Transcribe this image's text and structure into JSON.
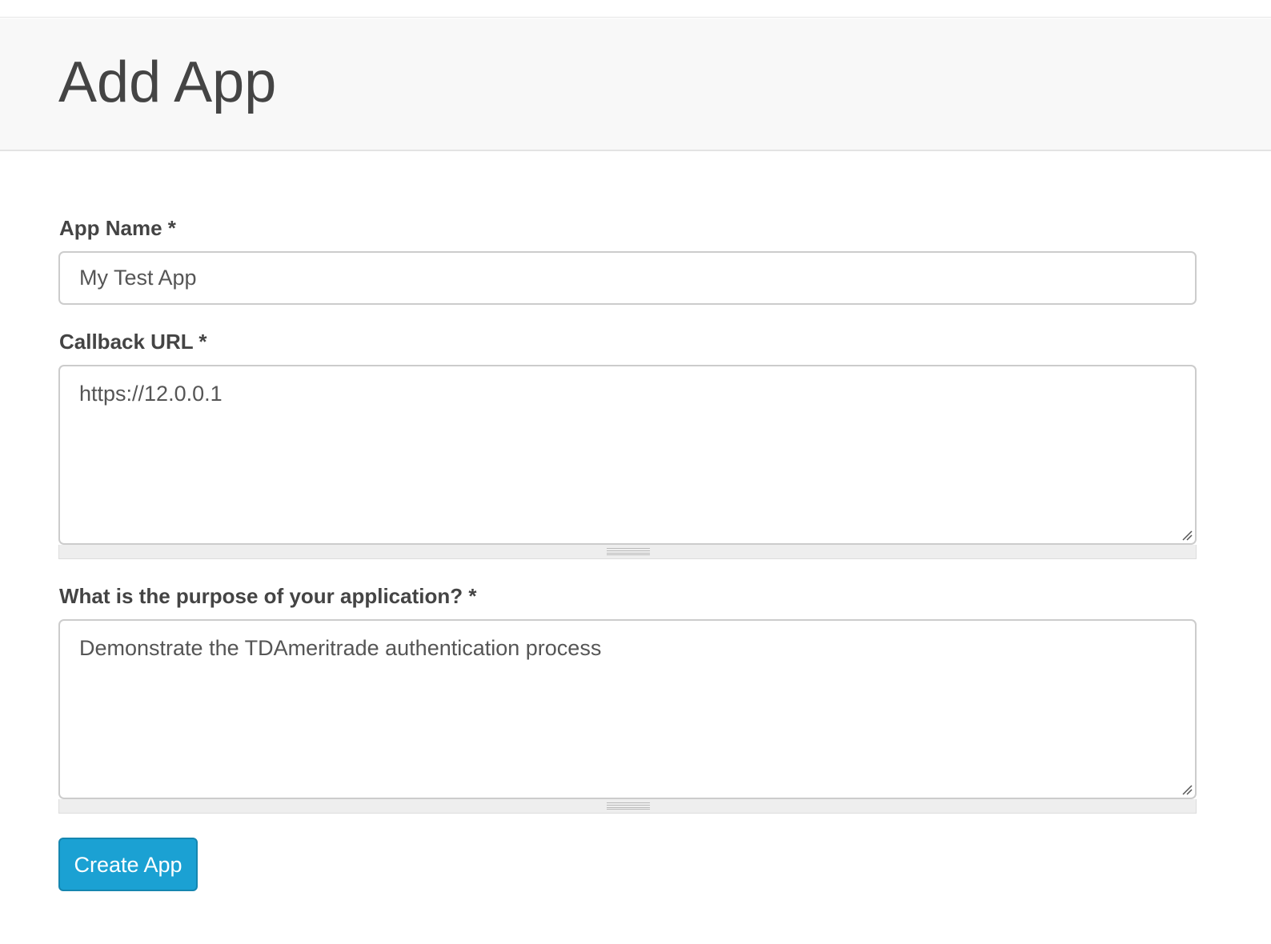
{
  "page": {
    "title": "Add App"
  },
  "form": {
    "app_name": {
      "label": "App Name *",
      "value": "My Test App"
    },
    "callback_url": {
      "label": "Callback URL *",
      "value": "https://12.0.0.1"
    },
    "purpose": {
      "label": "What is the purpose of your application? *",
      "value": "Demonstrate the TDAmeritrade authentication process"
    },
    "submit_label": "Create App"
  },
  "colors": {
    "button_background": "#1ba1d3",
    "header_background": "#f8f8f8",
    "text": "#444444"
  }
}
